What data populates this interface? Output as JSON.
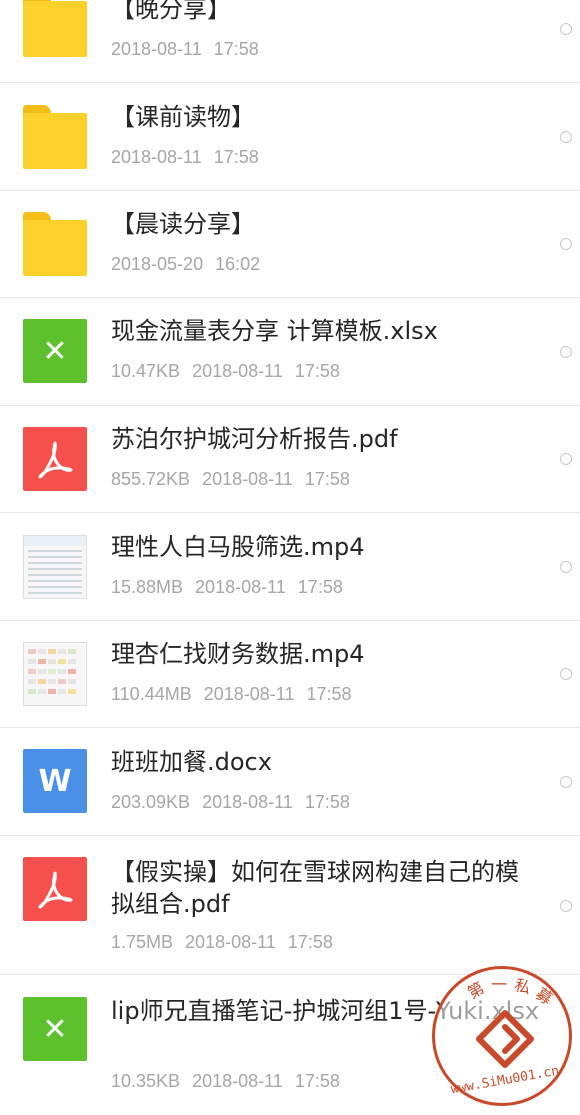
{
  "files": [
    {
      "type": "folder",
      "icon": "folder-icon",
      "name": "【晚分享】",
      "size": "",
      "date": "2018-08-11",
      "time": "17:58"
    },
    {
      "type": "folder",
      "icon": "folder-icon",
      "name": "【课前读物】",
      "size": "",
      "date": "2018-08-11",
      "time": "17:58"
    },
    {
      "type": "folder",
      "icon": "folder-icon",
      "name": "【晨读分享】",
      "size": "",
      "date": "2018-05-20",
      "time": "16:02"
    },
    {
      "type": "xlsx",
      "icon": "excel-icon",
      "glyph": "✕",
      "name": "现金流量表分享 计算模板.xlsx",
      "size": "10.47KB",
      "date": "2018-08-11",
      "time": "17:58"
    },
    {
      "type": "pdf",
      "icon": "pdf-icon",
      "name": "苏泊尔护城河分析报告.pdf",
      "size": "855.72KB",
      "date": "2018-08-11",
      "time": "17:58"
    },
    {
      "type": "video",
      "icon": "video-thumbnail-icon",
      "name": "理性人白马股筛选.mp4",
      "size": "15.88MB",
      "date": "2018-08-11",
      "time": "17:58"
    },
    {
      "type": "video",
      "icon": "video-thumbnail-icon",
      "name": "理杏仁找财务数据.mp4",
      "size": "110.44MB",
      "date": "2018-08-11",
      "time": "17:58"
    },
    {
      "type": "docx",
      "icon": "word-icon",
      "glyph": "W",
      "name": "班班加餐.docx",
      "size": "203.09KB",
      "date": "2018-08-11",
      "time": "17:58"
    },
    {
      "type": "pdf",
      "icon": "pdf-icon",
      "name": "【假实操】如何在雪球网构建自己的模拟组合.pdf",
      "size": "1.75MB",
      "date": "2018-08-11",
      "time": "17:58"
    },
    {
      "type": "xlsx",
      "icon": "excel-icon",
      "glyph": "✕",
      "name": "lip师兄直播笔记-护城河组1号-Yuki.xlsx",
      "size": "10.35KB",
      "date": "2018-08-11",
      "time": "17:58"
    }
  ],
  "watermark": {
    "text": "www.SiMu001.cn",
    "chars": [
      "第",
      "一",
      "私",
      "募"
    ],
    "color": "#c84a2a"
  }
}
